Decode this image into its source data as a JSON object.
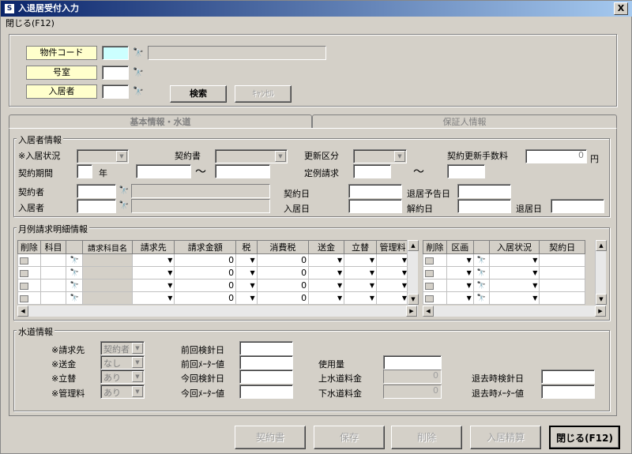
{
  "window": {
    "title": "入退居受付入力",
    "close_glyph": "X"
  },
  "menu": {
    "close": "閉じる(F12)"
  },
  "search": {
    "property_code_label": "物件コード",
    "room_label": "号室",
    "resident_label": "入居者",
    "search_button": "検索",
    "cancel_button": "ｷｬﾝｾﾙ"
  },
  "tabs": {
    "basic": "基本情報・水道",
    "guarantor": "保証人情報"
  },
  "resident_info": {
    "section_title": "入居者情報",
    "move_status_label": "※入居状況",
    "contract_doc_label": "契約書",
    "renewal_type_label": "更新区分",
    "renewal_fee_label": "契約更新手数料",
    "renewal_fee_value": "0",
    "yen_unit": "円",
    "contract_period_label": "契約期間",
    "year_unit": "年",
    "tilde": "～",
    "regular_billing_label": "定例請求",
    "contractor_label": "契約者",
    "contract_date_label": "契約日",
    "move_out_planned_label": "退居予告日",
    "resident_label": "入居者",
    "move_in_date_label": "入居日",
    "cancel_date_label": "解約日",
    "move_out_date_label": "退居日"
  },
  "billing": {
    "section_title": "月例請求明細情報",
    "columns": [
      "削除",
      "科目",
      "",
      "請求科目名",
      "請求先",
      "請求金額",
      "税",
      "消費税",
      "送金",
      "立替",
      "管理料"
    ],
    "rows": [
      {
        "amount": "0",
        "tax": "0"
      },
      {
        "amount": "0",
        "tax": "0"
      },
      {
        "amount": "0",
        "tax": "0"
      },
      {
        "amount": "0",
        "tax": "0"
      }
    ],
    "right_columns": [
      "削除",
      "区画",
      "",
      "入居状況",
      "契約日"
    ]
  },
  "water": {
    "section_title": "水道情報",
    "billing_to_label": "※請求先",
    "billing_to_value": "契約者",
    "remit_label": "※送金",
    "remit_value": "なし",
    "advance_label": "※立替",
    "advance_value": "あり",
    "mgmt_fee_label": "※管理料",
    "mgmt_fee_value": "あり",
    "prev_reading_date_label": "前回検針日",
    "prev_meter_label": "前回ﾒｰﾀｰ値",
    "curr_reading_date_label": "今回検針日",
    "curr_meter_label": "今回ﾒｰﾀｰ値",
    "usage_label": "使用量",
    "upper_water_fee_label": "上水道料金",
    "upper_water_fee_value": "0",
    "lower_water_fee_label": "下水道料金",
    "lower_water_fee_value": "0",
    "moveout_reading_date_label": "退去時検針日",
    "moveout_meter_label": "退去時ﾒｰﾀｰ値"
  },
  "footer": {
    "contract_button": "契約書",
    "save_button": "保存",
    "delete_button": "削除",
    "settle_button": "入居精算",
    "close_button": "閉じる(F12)"
  }
}
